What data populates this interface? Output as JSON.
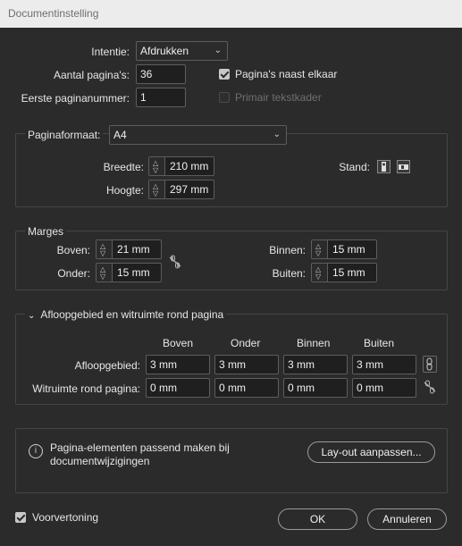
{
  "window": {
    "title": "Documentinstelling"
  },
  "top": {
    "intent_label": "Intentie:",
    "intent_value": "Afdrukken",
    "pages_label": "Aantal pagina's:",
    "pages_value": "36",
    "first_page_label": "Eerste paginanummer:",
    "first_page_value": "1",
    "facing_pages_label": "Pagina's naast elkaar",
    "facing_pages_checked": true,
    "primary_frame_label": "Primair tekstkader",
    "primary_frame_checked": false
  },
  "page_size": {
    "label": "Paginaformaat:",
    "value": "A4",
    "width_label": "Breedte:",
    "width_value": "210 mm",
    "height_label": "Hoogte:",
    "height_value": "297 mm",
    "orientation_label": "Stand:",
    "orientation_icons": [
      "portrait-icon",
      "landscape-icon"
    ]
  },
  "margins": {
    "title": "Marges",
    "top_label": "Boven:",
    "top_value": "21 mm",
    "bottom_label": "Onder:",
    "bottom_value": "15 mm",
    "inside_label": "Binnen:",
    "inside_value": "15 mm",
    "outside_label": "Buiten:",
    "outside_value": "15 mm"
  },
  "bleed": {
    "title": "Afloopgebied en witruimte rond pagina",
    "columns": [
      "Boven",
      "Onder",
      "Binnen",
      "Buiten"
    ],
    "bleed_label": "Afloopgebied:",
    "bleed_values": [
      "3 mm",
      "3 mm",
      "3 mm",
      "3 mm"
    ],
    "slug_label": "Witruimte rond pagina:",
    "slug_values": [
      "0 mm",
      "0 mm",
      "0 mm",
      "0 mm"
    ]
  },
  "info": {
    "text_line1": "Pagina-elementen passend maken bij",
    "text_line2": "documentwijzigingen",
    "adjust_button": "Lay-out aanpassen..."
  },
  "footer": {
    "preview_label": "Voorvertoning",
    "preview_checked": true,
    "ok_label": "OK",
    "cancel_label": "Annuleren"
  },
  "colors": {
    "background": "#2b2b2b",
    "titlebar": "#ececec",
    "field_bg": "#1f1f1f",
    "border": "#5d5d5d"
  }
}
